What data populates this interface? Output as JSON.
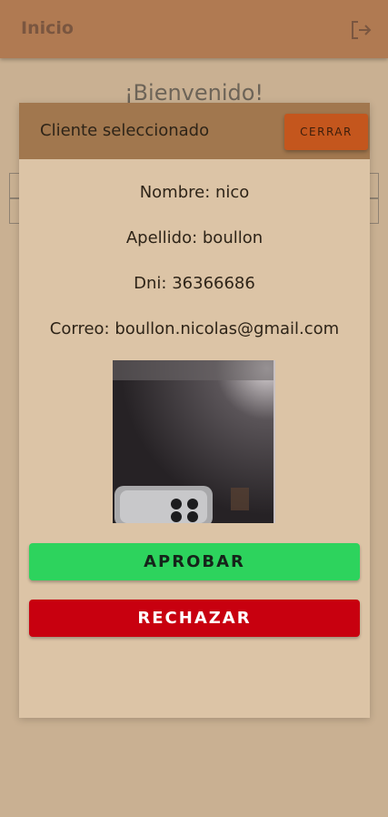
{
  "header": {
    "title": "Inicio",
    "logout_icon": "logout-icon"
  },
  "page": {
    "welcome": "¡Bienvenido!"
  },
  "modal": {
    "title": "Cliente seleccionado",
    "close_label": "CERRAR",
    "client": {
      "nombre": "Nombre: nico",
      "apellido": "Apellido: boullon",
      "dni": "Dni: 36366686",
      "correo": "Correo: boullon.nicolas@gmail.com"
    },
    "approve_label": "APROBAR",
    "reject_label": "RECHAZAR"
  },
  "colors": {
    "header_bg": "#b07a52",
    "modal_bg": "#dcc4a6",
    "close_button": "#c4561d",
    "approve": "#2dd35d",
    "reject": "#c8000f"
  }
}
